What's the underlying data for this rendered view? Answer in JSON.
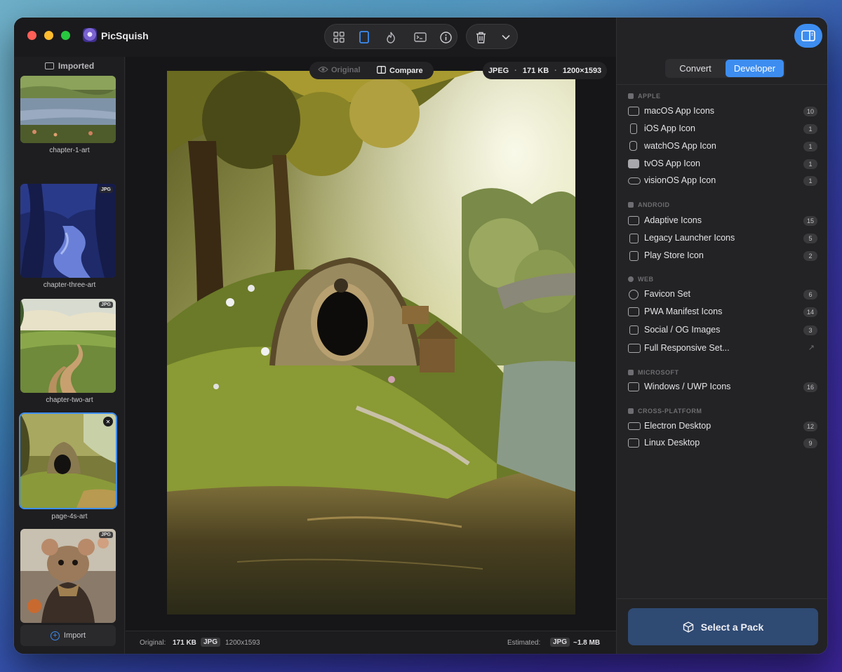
{
  "app": {
    "title": "PicSquish"
  },
  "toolbar": {
    "grid_icon": "grid-icon",
    "single_icon": "single-view-icon",
    "flame_icon": "flame-icon",
    "terminal_icon": "terminal-icon",
    "info_icon": "info-icon",
    "trash_icon": "trash-icon",
    "chevron_icon": "chevron-down-icon"
  },
  "sidebar": {
    "header": "Imported",
    "items": [
      {
        "name": "chapter-1-art",
        "badge": ""
      },
      {
        "name": "chapter-three-art",
        "badge": "JPG"
      },
      {
        "name": "chapter-two-art",
        "badge": "JPG"
      },
      {
        "name": "page-4s-art",
        "badge": ""
      },
      {
        "name": "page-5-art",
        "badge": "JPG"
      }
    ],
    "import_label": "Import"
  },
  "viewer": {
    "original_label": "Original",
    "compare_label": "Compare",
    "format": "JPEG",
    "size": "171 KB",
    "dimensions": "1200×1593"
  },
  "status": {
    "original_label": "Original:",
    "original_size": "171 KB",
    "original_format": "JPG",
    "original_dims": "1200x1593",
    "estimated_label": "Estimated:",
    "estimated_format": "JPG",
    "estimated_size": "~1.8 MB"
  },
  "panel": {
    "tabs": [
      "Convert",
      "Developer"
    ],
    "active_tab": "Developer",
    "sections": [
      {
        "title": "APPLE",
        "packs": [
          {
            "label": "macOS App Icons",
            "count": "10"
          },
          {
            "label": "iOS App Icon",
            "count": "1"
          },
          {
            "label": "watchOS App Icon",
            "count": "1"
          },
          {
            "label": "tvOS App Icon",
            "count": "1"
          },
          {
            "label": "visionOS App Icon",
            "count": "1"
          }
        ]
      },
      {
        "title": "ANDROID",
        "packs": [
          {
            "label": "Adaptive Icons",
            "count": "15"
          },
          {
            "label": "Legacy Launcher Icons",
            "count": "5"
          },
          {
            "label": "Play Store Icon",
            "count": "2"
          }
        ]
      },
      {
        "title": "WEB",
        "packs": [
          {
            "label": "Favicon Set",
            "count": "6"
          },
          {
            "label": "PWA Manifest Icons",
            "count": "14"
          },
          {
            "label": "Social / OG Images",
            "count": "3"
          },
          {
            "label": "Full Responsive Set...",
            "count": "↗"
          }
        ]
      },
      {
        "title": "MICROSOFT",
        "packs": [
          {
            "label": "Windows / UWP Icons",
            "count": "16"
          }
        ]
      },
      {
        "title": "CROSS-PLATFORM",
        "packs": [
          {
            "label": "Electron Desktop",
            "count": "12"
          },
          {
            "label": "Linux Desktop",
            "count": "9"
          }
        ]
      }
    ],
    "select_pack_label": "Select a Pack"
  },
  "colors": {
    "accent": "#3d8df0",
    "select_button": "#2f4a73"
  }
}
